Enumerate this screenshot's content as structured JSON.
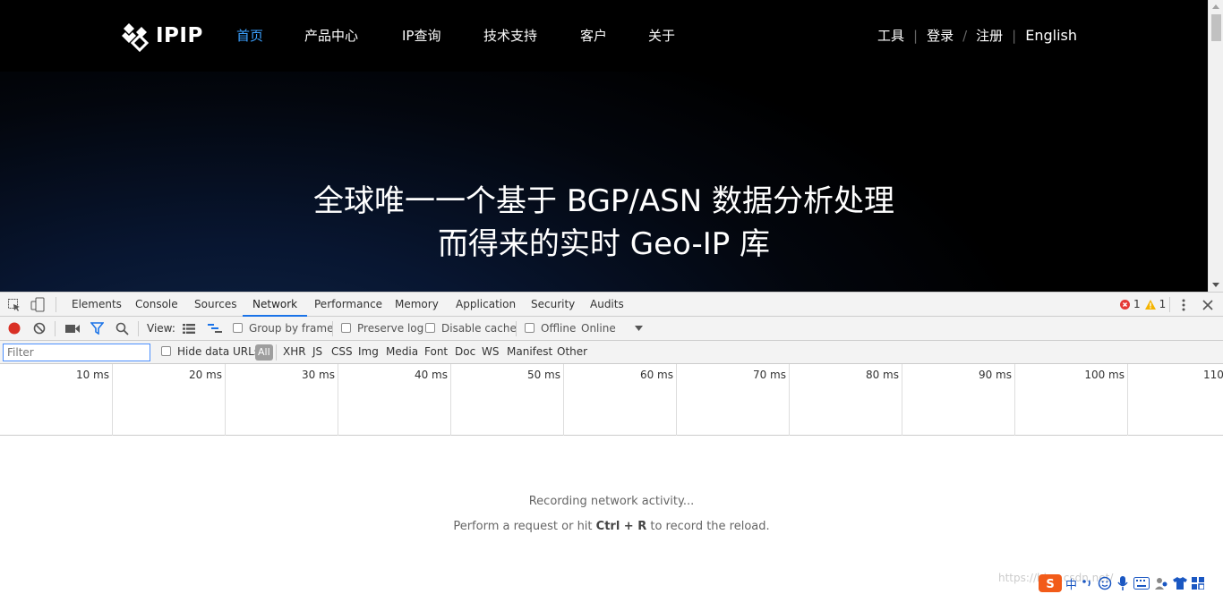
{
  "site": {
    "logo_text": "IPIP",
    "nav": [
      "首页",
      "产品中心",
      "IP查询",
      "技术支持",
      "客户",
      "关于"
    ],
    "right_nav": [
      "工具",
      "登录",
      "注册",
      "English"
    ],
    "separators": [
      "|",
      "/",
      "|"
    ],
    "hero_line1": "全球唯一一个基于 BGP/ASN 数据分析处理",
    "hero_line2": "而得来的实时 Geo-IP 库",
    "accent_color": "#3ba0ff"
  },
  "devtools": {
    "tabs": [
      "Elements",
      "Console",
      "Sources",
      "Network",
      "Performance",
      "Memory",
      "Application",
      "Security",
      "Audits"
    ],
    "active_tab": "Network",
    "error_count": "1",
    "warning_count": "1",
    "toolbar": {
      "view_label": "View:",
      "group_by_frame": "Group by frame",
      "preserve_log": "Preserve log",
      "disable_cache": "Disable cache",
      "offline": "Offline",
      "throttle": "Online"
    },
    "filter": {
      "placeholder": "Filter",
      "hide_data_urls": "Hide data URLs",
      "types": [
        "All",
        "XHR",
        "JS",
        "CSS",
        "Img",
        "Media",
        "Font",
        "Doc",
        "WS",
        "Manifest",
        "Other"
      ]
    },
    "timeline_ticks": [
      "10 ms",
      "20 ms",
      "30 ms",
      "40 ms",
      "50 ms",
      "60 ms",
      "70 ms",
      "80 ms",
      "90 ms",
      "100 ms",
      "110"
    ],
    "empty": {
      "line1": "Recording network activity...",
      "line2_prefix": "Perform a request or hit ",
      "line2_keys": "Ctrl + R",
      "line2_suffix": " to record the reload."
    }
  },
  "watermark": "https://blog.csdn.net/",
  "tray_label": "中"
}
